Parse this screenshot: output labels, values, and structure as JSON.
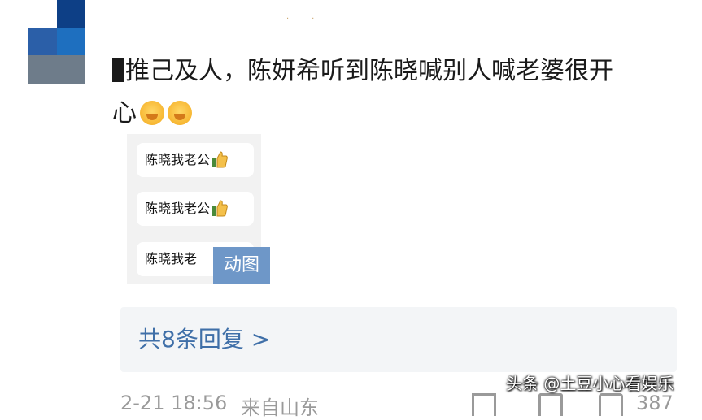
{
  "post": {
    "text": "推己及人，陈妍希听到陈晓喊别人喊老婆很开心",
    "text_line1": "推己及人，陈妍希听到陈晓喊别人喊老婆很开",
    "text_line2": "心",
    "emojis": [
      "crying-laughing-emoji",
      "crying-laughing-emoji"
    ]
  },
  "gif": {
    "bubbles": [
      "陈晓我老公",
      "陈晓我老公",
      "陈晓我老"
    ],
    "badge": "动图",
    "thumb_icon": "thumbs-up-icon"
  },
  "replies": {
    "label": "共8条回复 >"
  },
  "footer": {
    "time": "2-21 18:56",
    "source": "来自山东",
    "like_count": "387",
    "icons": [
      "share-icon",
      "comment-icon",
      "like-icon"
    ]
  },
  "watermark": "头条 @土豆小心看娱乐",
  "colors": {
    "link": "#3f6fa8",
    "badge": "#6e97c8",
    "reply_bg": "#f3f5f7",
    "meta": "#9a9a9a"
  }
}
